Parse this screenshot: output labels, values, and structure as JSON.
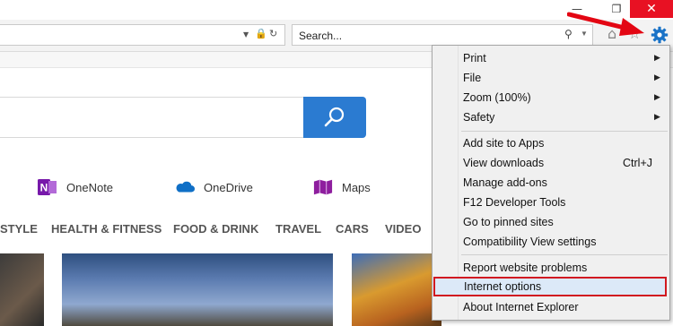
{
  "window": {
    "min_icon": "minimize-icon",
    "restore_icon": "restore-icon",
    "close_icon": "close-icon"
  },
  "toolbar": {
    "search_placeholder": "Search...",
    "icons": [
      "dropdown-caret-icon",
      "lock-icon",
      "refresh-icon",
      "search-icon",
      "home-icon",
      "favorites-star-icon",
      "gear-icon"
    ]
  },
  "apps": [
    {
      "label": "OneNote",
      "icon": "onenote-icon",
      "color": "#7719aa"
    },
    {
      "label": "OneDrive",
      "icon": "onedrive-icon",
      "color": "#0f6fc6"
    },
    {
      "label": "Maps",
      "icon": "maps-icon",
      "color": "#8e1e9e"
    }
  ],
  "nav": [
    "STYLE",
    "HEALTH & FITNESS",
    "FOOD & DRINK",
    "TRAVEL",
    "CARS",
    "VIDEO"
  ],
  "menu": {
    "items": [
      {
        "label": "Print",
        "submenu": true
      },
      {
        "label": "File",
        "submenu": true
      },
      {
        "label": "Zoom (100%)",
        "submenu": true
      },
      {
        "label": "Safety",
        "submenu": true
      },
      {
        "label": "Add site to Apps"
      },
      {
        "label": "View downloads",
        "shortcut": "Ctrl+J"
      },
      {
        "label": "Manage add-ons"
      },
      {
        "label": "F12 Developer Tools"
      },
      {
        "label": "Go to pinned sites"
      },
      {
        "label": "Compatibility View settings"
      },
      {
        "label": "Report website problems"
      },
      {
        "label": "Internet options",
        "highlighted": true
      },
      {
        "label": "About Internet Explorer"
      }
    ]
  },
  "colors": {
    "accent_blue": "#2b7bd1",
    "highlight_border": "#d11920",
    "annotation_arrow": "#e30613",
    "gear": "#1a73c7"
  }
}
